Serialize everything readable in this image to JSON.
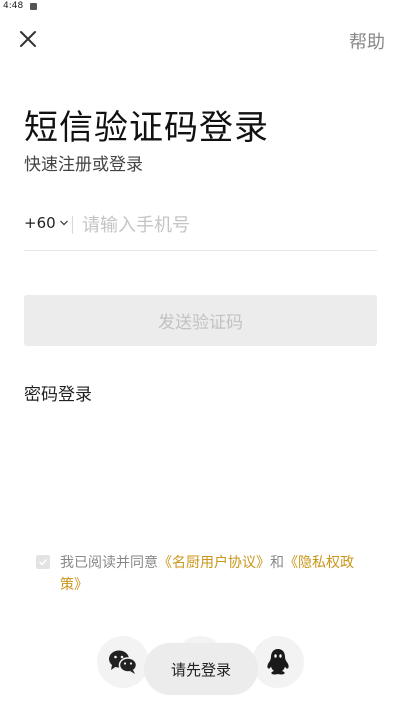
{
  "status_bar": {
    "time": "4:48"
  },
  "header": {
    "help_label": "帮助"
  },
  "title": "短信验证码登录",
  "subtitle": "快速注册或登录",
  "phone": {
    "country_code": "+60",
    "placeholder": "请输入手机号"
  },
  "send_button_label": "发送验证码",
  "password_login_label": "密码登录",
  "agreement": {
    "prefix": "我已阅读并同意",
    "link1": "《名厨用户协议》",
    "and": "和",
    "link2": "《隐私权政策》"
  },
  "social": [
    "wechat-icon",
    "weibo-icon",
    "qq-icon"
  ],
  "toast": "请先登录",
  "colors": {
    "link": "#c9961a",
    "button_disabled_bg": "#ececec",
    "button_disabled_text": "#c2c2c2"
  }
}
